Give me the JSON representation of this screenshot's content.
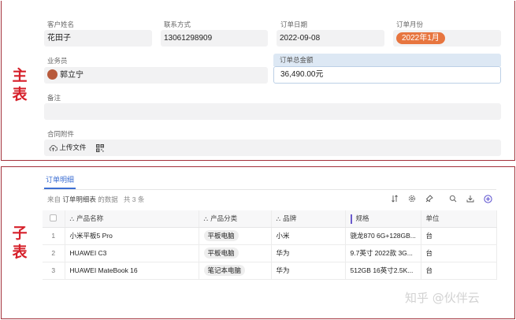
{
  "side_labels": {
    "main": "主\n表",
    "sub": "子\n表"
  },
  "main": {
    "fields": {
      "customer": {
        "label": "客户姓名",
        "value": "花田子"
      },
      "contact": {
        "label": "联系方式",
        "value": "13061298909"
      },
      "order_date": {
        "label": "订单日期",
        "value": "2022-09-08"
      },
      "order_month": {
        "label": "订单月份",
        "value": "2022年1月"
      },
      "salesman": {
        "label": "业务员",
        "value": "郭立宁"
      },
      "total": {
        "label": "订单总金额",
        "value": "36,490.00元"
      },
      "remark": {
        "label": "备注",
        "value": ""
      },
      "attachment": {
        "label": "合同附件",
        "upload_label": "上传文件"
      }
    }
  },
  "sub": {
    "tab_label": "订单明细",
    "from_prefix": "来自",
    "from_table": "订单明细表",
    "from_suffix": "的数据",
    "count_text": "共 3 条",
    "columns": [
      "产品名称",
      "产品分类",
      "品牌",
      "规格",
      "单位"
    ],
    "rows": [
      {
        "num": "1",
        "name": "小米平板5 Pro",
        "category": "平板电脑",
        "brand": "小米",
        "spec": "骁龙870 6G+128GB...",
        "unit": "台"
      },
      {
        "num": "2",
        "name": "HUAWEI C3",
        "category": "平板电脑",
        "brand": "华为",
        "spec": "9.7英寸 2022款 3G...",
        "unit": "台"
      },
      {
        "num": "3",
        "name": "HUAWEI MateBook 16",
        "category": "笔记本电脑",
        "brand": "华为",
        "spec": "512GB 16英寸2.5K...",
        "unit": "台"
      }
    ]
  },
  "watermark": "知乎 @伙伴云",
  "colors": {
    "accent": "#3d6fd3",
    "frame": "#a3303a",
    "label_red": "#d6202a",
    "pill_orange": "#e7753f"
  }
}
